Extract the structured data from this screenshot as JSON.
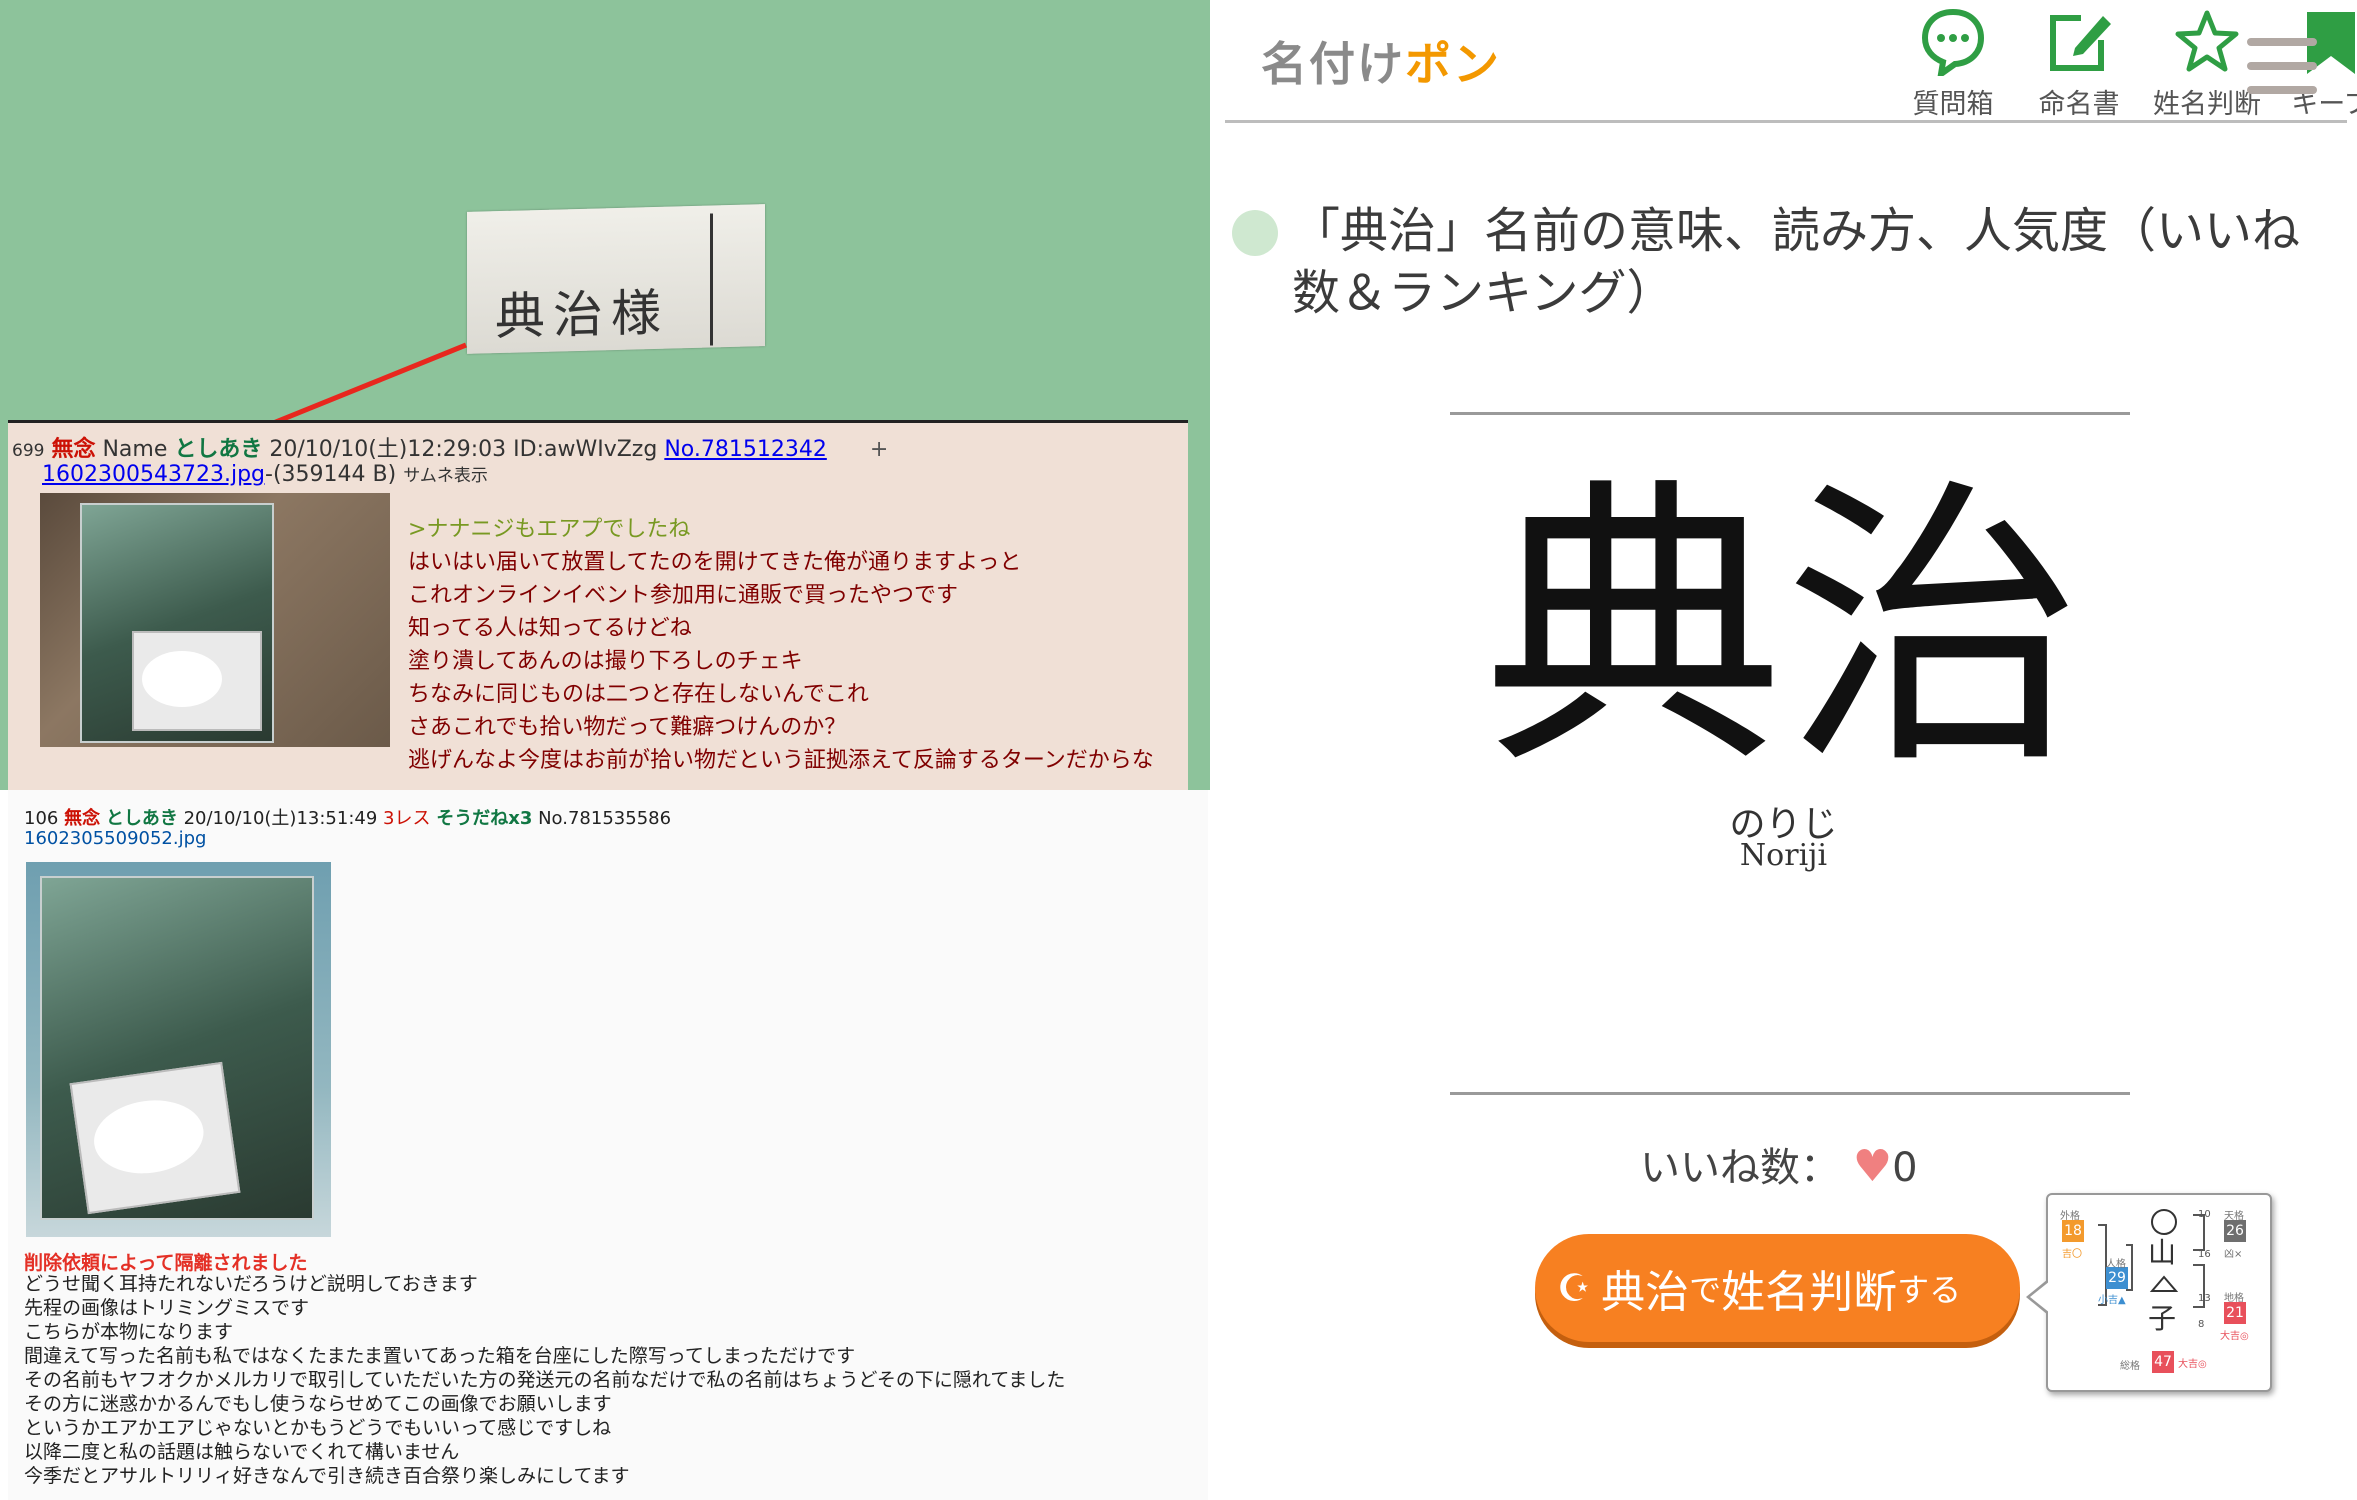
{
  "left": {
    "label_crop_text": "典治様",
    "post1": {
      "number": "699",
      "subject": "無念",
      "name_label": "Name",
      "name": "としあき",
      "datetime": "20/10/10(土)12:29:03 ID:awWIvZzg",
      "post_no": "No.781512342",
      "plus": "+",
      "file_name": "1602300543723.jpg",
      "file_size": "-(359144 B)",
      "thumb_note": "サムネ表示",
      "lines": [
        ">ナナニジもエアプでしたね",
        "はいはい届いて放置してたのを開けてきた俺が通りますよっと",
        "これオンラインイベント参加用に通販で買ったやつです",
        "知ってる人は知ってるけどね",
        "塗り潰してあんのは撮り下ろしのチェキ",
        "ちなみに同じものは二つと存在しないんでこれ",
        "さあこれでも拾い物だって難癖つけんのか？",
        "逃げんなよ今度はお前が拾い物だという証拠添えて反論するターンだからな"
      ]
    },
    "post2": {
      "number": "106",
      "subject": "無念",
      "name": "としあき",
      "datetime": "20/10/10(土)13:51:49",
      "res": "3レス",
      "sodane": "そうだねx3",
      "post_no": "No.781535586",
      "file_name": "1602305509052.jpg",
      "deleted": "削除依頼によって隔離されました",
      "lines": [
        "どうせ聞く耳持たれないだろうけど説明しておきます",
        "先程の画像はトリミングミスです",
        "こちらが本物になります",
        "間違えて写った名前も私ではなくたまたま置いてあった箱を台座にした際写ってしまっただけです",
        "その名前もヤフオクかメルカリで取引していただいた方の発送元の名前なだけで私の名前はちょうどその下に隠れてました",
        "その方に迷惑かかるんでもし使うならせめてこの画像でお願いします",
        "というかエアかエアじゃないとかもうどうでもいいって感じですしね",
        "以降二度と私の話題は触らないでくれて構いません",
        "今季だとアサルトリリィ好きなんで引き続き百合祭り楽しみにしてます"
      ]
    }
  },
  "right": {
    "logo_main": "名付け",
    "logo_accent": "ポン",
    "nav": [
      {
        "label": "質問箱",
        "icon": "speech-bubble-icon"
      },
      {
        "label": "命名書",
        "icon": "pen-square-icon"
      },
      {
        "label": "姓名判断",
        "icon": "star-icon"
      },
      {
        "label": "キープ",
        "icon": "bookmark-icon"
      }
    ],
    "heading": "「典治」名前の意味、読み方、人気度（いいね数＆ランキング）",
    "big_name": "典治",
    "yomi": "のりじ",
    "romaji": "Noriji",
    "likes_label": "いいね数：",
    "likes_count": "0",
    "judge_button": {
      "name": "典治",
      "particle": "で",
      "action": "姓名判断",
      "suffix": "する"
    },
    "seimei_diagram": {
      "chars": [
        "山",
        "子"
      ],
      "boxes": [
        {
          "value": "18",
          "color": "#f39a2d"
        },
        {
          "value": "29",
          "color": "#3d8fd1"
        },
        {
          "value": "26",
          "color": "#6e6e6e"
        },
        {
          "value": "21",
          "color": "#e8505b"
        },
        {
          "value": "47",
          "color": "#e8505b"
        }
      ],
      "small_numbers": [
        "10",
        "16",
        "13",
        "8"
      ],
      "notes": [
        "外格",
        "吉〇",
        "人格",
        "小吉▲",
        "天格",
        "凶×",
        "地格",
        "大吉◎",
        "総格",
        "大吉◎"
      ]
    },
    "colors": {
      "accent": "#f39800",
      "green": "#2f9e44",
      "button": "#f78021"
    }
  }
}
